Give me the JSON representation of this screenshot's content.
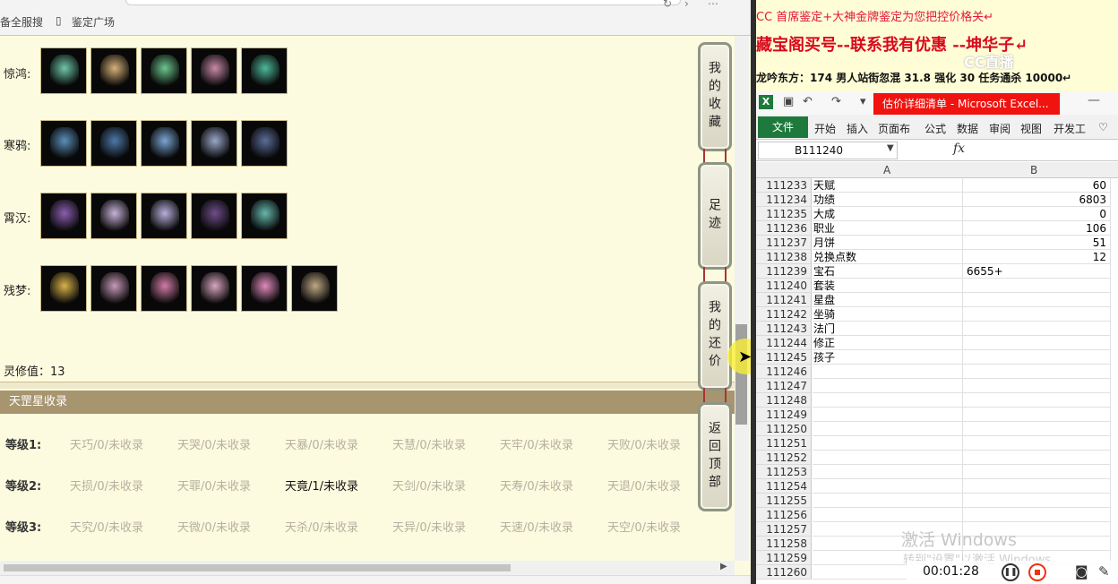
{
  "browser": {
    "bookmarks": [
      "备全服搜",
      "鉴定广场"
    ]
  },
  "collection_rows": [
    {
      "label": "惊鸿:",
      "items": [
        {
          "name": "costume-item-icon",
          "color": "#6fc7a8"
        },
        {
          "name": "headgear-item-icon",
          "color": "#d7b27a"
        },
        {
          "name": "ring-item-icon",
          "color": "#6dc68e"
        },
        {
          "name": "ribbon-item-icon",
          "color": "#c98aa8"
        },
        {
          "name": "mask-item-icon",
          "color": "#4fb99a"
        }
      ]
    },
    {
      "label": "寒鸦:",
      "items": [
        {
          "name": "costume-item-icon",
          "color": "#5b8fb9"
        },
        {
          "name": "wings-item-icon",
          "color": "#4d79a8"
        },
        {
          "name": "blade-item-icon",
          "color": "#7aa6d3"
        },
        {
          "name": "ring-item-icon",
          "color": "#9aa7c9"
        },
        {
          "name": "cloak-item-icon",
          "color": "#5d6d9a"
        }
      ]
    },
    {
      "label": "霄汉:",
      "items": [
        {
          "name": "costume-item-icon",
          "color": "#8b5fb0"
        },
        {
          "name": "mask-item-icon",
          "color": "#c7b2d9"
        },
        {
          "name": "ring-item-icon",
          "color": "#b9b0de"
        },
        {
          "name": "cloak-item-icon",
          "color": "#6f4e8a"
        },
        {
          "name": "staff-item-icon",
          "color": "#66b8ae"
        }
      ]
    },
    {
      "label": "残梦:",
      "items": [
        {
          "name": "staff-item-icon",
          "color": "#d8b24a"
        },
        {
          "name": "costume-item-icon",
          "color": "#c79ab8"
        },
        {
          "name": "wings-item-icon",
          "color": "#d37ca8"
        },
        {
          "name": "cloak-item-icon",
          "color": "#d9a6c0"
        },
        {
          "name": "ribbon-item-icon",
          "color": "#e08bbd"
        },
        {
          "name": "ring-item-icon",
          "color": "#bfa884"
        }
      ]
    }
  ],
  "lingxiu": "灵修值：13",
  "section_title": "天罡星收录",
  "levels": [
    {
      "label": "等级1:",
      "entries": [
        "天巧/0/未收录",
        "天哭/0/未收录",
        "天暴/0/未收录",
        "天慧/0/未收录",
        "天牢/0/未收录",
        "天败/0/未收录"
      ],
      "active": []
    },
    {
      "label": "等级2:",
      "entries": [
        "天损/0/未收录",
        "天罪/0/未收录",
        "天竟/1/未收录",
        "天剑/0/未收录",
        "天寿/0/未收录",
        "天退/0/未收录"
      ],
      "active": [
        2
      ]
    },
    {
      "label": "等级3:",
      "entries": [
        "天究/0/未收录",
        "天微/0/未收录",
        "天杀/0/未收录",
        "天异/0/未收录",
        "天速/0/未收录",
        "天空/0/未收录"
      ],
      "active": []
    }
  ],
  "side_buttons": [
    "我的收藏",
    "足迹",
    "我的还价",
    "返回顶部"
  ],
  "doc": {
    "line1": "CC 首席鉴定+大神金牌鉴定为您把控价格关↵",
    "line2": "藏宝阁买号--联系我有优惠 --坤华子↵",
    "line3": "龙吟东方：174 男人站街忽混 31.8 强化 30 任务通杀 10000↵",
    "watermark": "CC直播"
  },
  "excel": {
    "title": "估价详细清单 - Microsoft Excel...",
    "tabs": [
      "文件",
      "开始",
      "插入",
      "页面布",
      "公式",
      "数据",
      "审阅",
      "视图",
      "开发工"
    ],
    "name_box": "B111240",
    "fx": "fx",
    "columns": [
      "A",
      "B"
    ],
    "rows": [
      {
        "n": "111233",
        "a": "天赋",
        "b": "60"
      },
      {
        "n": "111234",
        "a": "功绩",
        "b": "6803"
      },
      {
        "n": "111235",
        "a": "大成",
        "b": "0"
      },
      {
        "n": "111236",
        "a": "职业",
        "b": "106"
      },
      {
        "n": "111237",
        "a": "月饼",
        "b": "51"
      },
      {
        "n": "111238",
        "a": "兑换点数",
        "b": "12"
      },
      {
        "n": "111239",
        "a": "宝石",
        "b": "6655+"
      },
      {
        "n": "111240",
        "a": "套装",
        "b": ""
      },
      {
        "n": "111241",
        "a": "星盘",
        "b": ""
      },
      {
        "n": "111242",
        "a": "坐骑",
        "b": ""
      },
      {
        "n": "111243",
        "a": "法门",
        "b": ""
      },
      {
        "n": "111244",
        "a": "修正",
        "b": ""
      },
      {
        "n": "111245",
        "a": "孩子",
        "b": ""
      },
      {
        "n": "111246",
        "a": "",
        "b": ""
      },
      {
        "n": "111247",
        "a": "",
        "b": ""
      },
      {
        "n": "111248",
        "a": "",
        "b": ""
      },
      {
        "n": "111249",
        "a": "",
        "b": ""
      },
      {
        "n": "111250",
        "a": "",
        "b": ""
      },
      {
        "n": "111251",
        "a": "",
        "b": ""
      },
      {
        "n": "111252",
        "a": "",
        "b": ""
      },
      {
        "n": "111253",
        "a": "",
        "b": ""
      },
      {
        "n": "111254",
        "a": "",
        "b": ""
      },
      {
        "n": "111255",
        "a": "",
        "b": ""
      },
      {
        "n": "111256",
        "a": "",
        "b": ""
      },
      {
        "n": "111257",
        "a": "",
        "b": ""
      },
      {
        "n": "111258",
        "a": "",
        "b": ""
      },
      {
        "n": "111259",
        "a": "",
        "b": ""
      },
      {
        "n": "111260",
        "a": "",
        "b": ""
      }
    ]
  },
  "windows_activation": {
    "line1": "激活 Windows",
    "line2": "转到\"设置\"以激活 Windows。"
  },
  "recorder": {
    "time": "00:01:28"
  }
}
